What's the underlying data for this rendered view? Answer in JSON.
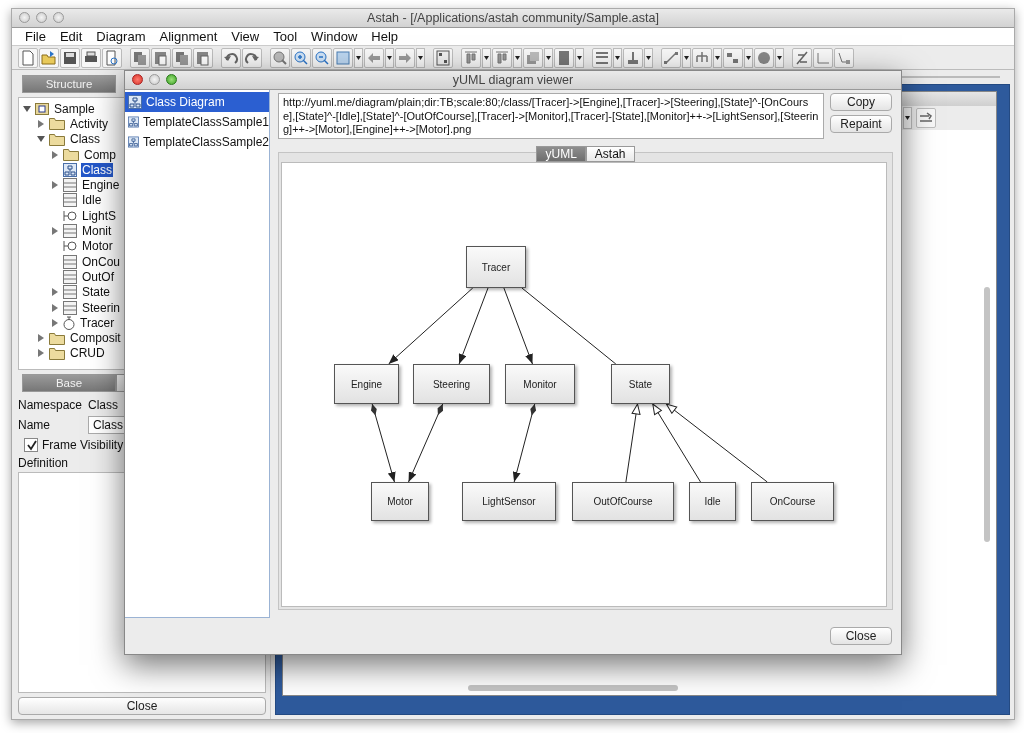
{
  "window": {
    "title": "Astah - [/Applications/astah community/Sample.asta]"
  },
  "menu": [
    "File",
    "Edit",
    "Diagram",
    "Alignment",
    "View",
    "Tool",
    "Window",
    "Help"
  ],
  "structure": {
    "tab": "Structure",
    "tree": [
      {
        "label": "Sample",
        "kind": "project",
        "expanded": true,
        "selected": false,
        "children": [
          {
            "label": "Activity",
            "kind": "folder",
            "expanded": false,
            "selected": false
          },
          {
            "label": "Class",
            "kind": "folder",
            "expanded": true,
            "selected": false,
            "children": [
              {
                "label": "Comp",
                "kind": "folder",
                "expanded": false,
                "selected": false
              },
              {
                "label": "Class",
                "kind": "diagram",
                "selected": true
              },
              {
                "label": "Engine",
                "kind": "class",
                "expanded": false,
                "selected": false
              },
              {
                "label": "Idle",
                "kind": "class",
                "selected": false
              },
              {
                "label": "LightS",
                "kind": "interface",
                "selected": false
              },
              {
                "label": "Monit",
                "kind": "class",
                "expanded": false,
                "selected": false
              },
              {
                "label": "Motor",
                "kind": "interface",
                "selected": false
              },
              {
                "label": "OnCou",
                "kind": "class",
                "selected": false
              },
              {
                "label": "OutOf",
                "kind": "class",
                "selected": false
              },
              {
                "label": "State",
                "kind": "class",
                "expanded": false,
                "selected": false
              },
              {
                "label": "Steerin",
                "kind": "class",
                "expanded": false,
                "selected": false
              },
              {
                "label": "Tracer",
                "kind": "active",
                "expanded": false,
                "selected": false
              }
            ]
          },
          {
            "label": "Composit",
            "kind": "folder",
            "expanded": false,
            "selected": false
          },
          {
            "label": "CRUD",
            "kind": "folder",
            "expanded": false,
            "selected": false
          }
        ]
      }
    ]
  },
  "properties": {
    "tab": "Base",
    "namespace_label": "Namespace",
    "namespace": "Class",
    "name_label": "Name",
    "name": "Class",
    "frame_visibility": {
      "label": "Frame Visibility",
      "checked": true
    },
    "definition_label": "Definition"
  },
  "close_button": "Close",
  "dialog": {
    "title": "yUML diagram viewer",
    "diagrams": [
      {
        "label": "Class Diagram",
        "selected": true
      },
      {
        "label": "TemplateClassSample1",
        "selected": false
      },
      {
        "label": "TemplateClassSample2",
        "selected": false
      }
    ],
    "url": "http://yuml.me/diagram/plain;dir:TB;scale:80;/class/[Tracer]->[Engine],[Tracer]->[Steering],[State]^-[OnCourse],[State]^-[Idle],[State]^-[OutOfCourse],[Tracer]->[Monitor],[Tracer]-[State],[Monitor]++->[LightSensor],[Steering]++->[Motor],[Engine]++->[Motor].png",
    "buttons": [
      "Copy",
      "Repaint"
    ],
    "tabs": [
      {
        "label": "yUML",
        "selected": true
      },
      {
        "label": "Astah",
        "selected": false
      }
    ],
    "nodes": [
      "Tracer",
      "Engine",
      "Steering",
      "Monitor",
      "State",
      "Motor",
      "LightSensor",
      "OutOfCourse",
      "Idle",
      "OnCourse"
    ],
    "close_button": "Close"
  }
}
